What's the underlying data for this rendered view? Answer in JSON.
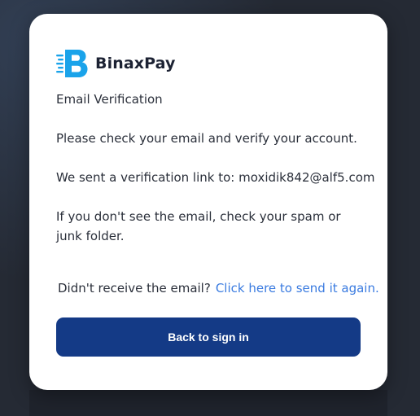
{
  "brand": {
    "name": "BinaxPay",
    "logo_icon": "binaxpay-b-logo-icon",
    "logo_color": "#1aa3ea"
  },
  "content": {
    "heading": "Email Verification",
    "instruction": "Please check your email and verify your account.",
    "sent_to": "We sent a verification link to: moxidik842@alf5.com",
    "spam_note": "If you don't see the email, check your spam or junk folder."
  },
  "resend": {
    "prompt": "Didn't receive the email?",
    "link_label": "Click here to send it again.",
    "link_color": "#3a7be0"
  },
  "actions": {
    "back_label": "Back to sign in",
    "button_color": "#143a86"
  },
  "theme": {
    "background": "#252a34",
    "card": "#ffffff"
  }
}
